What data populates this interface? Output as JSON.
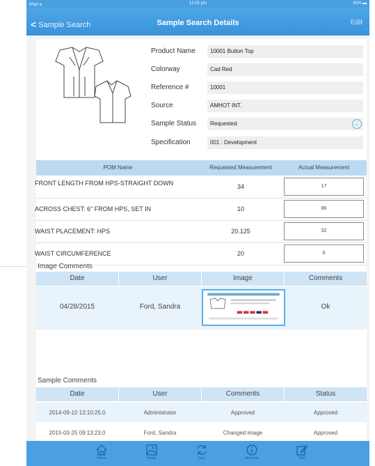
{
  "status_bar": {
    "left": "iPad ᯤ",
    "time": "12:01 pm",
    "battery": "91%"
  },
  "nav": {
    "back_label": "Sample Search",
    "title": "Sample Search Details",
    "edit_label": "Edit"
  },
  "product": {
    "fields": [
      {
        "label": "Product Name",
        "value": "10001 Button Top"
      },
      {
        "label": "Colorway",
        "value": "Cad Red"
      },
      {
        "label": "Reference #",
        "value": "10001"
      },
      {
        "label": "Source",
        "value": "AMHOT INT."
      },
      {
        "label": "Sample Status",
        "value": "Requested"
      },
      {
        "label": "Specification",
        "value": "001 : Development"
      }
    ]
  },
  "pom": {
    "headers": [
      "POM Name",
      "Requested Measurement",
      "Actual Measurement"
    ],
    "rows": [
      {
        "name": "FRONT LENGTH FROM HPS-STRAIGHT DOWN",
        "requested": "34",
        "actual": "17"
      },
      {
        "name": "ACROSS CHEST: 6\" FROM HPS, SET IN",
        "requested": "10",
        "actual": "86"
      },
      {
        "name": "WAIST PLACEMENT: HPS",
        "requested": "20.125",
        "actual": "32"
      },
      {
        "name": "WAIST CIRCUMFERENCE",
        "requested": "20",
        "actual": "0"
      }
    ]
  },
  "image_comments": {
    "section_label": "Image Comments",
    "headers": [
      "Date",
      "User",
      "Image",
      "Comments"
    ],
    "rows": [
      {
        "date": "04/28/2015",
        "user": "Ford, Sandra",
        "comment": "Ok"
      }
    ]
  },
  "sample_comments": {
    "section_label": "Sample Comments",
    "headers": [
      "Date",
      "User",
      "Comments",
      "Status"
    ],
    "rows": [
      {
        "date": "2014-09-10 13:10:25.0",
        "user": "Administrator",
        "comment": "Approved",
        "status": "Approved"
      },
      {
        "date": "2015-03-25 09:13:23.0",
        "user": "Ford, Sandra",
        "comment": "Changed image",
        "status": "Approved"
      }
    ]
  },
  "tabs": [
    {
      "label": "Home",
      "icon": "home-icon"
    },
    {
      "label": "Image",
      "icon": "image-icon"
    },
    {
      "label": "Sync",
      "icon": "sync-icon"
    },
    {
      "label": "About Us",
      "icon": "info-icon"
    },
    {
      "label": "T&C",
      "icon": "edit-icon"
    }
  ],
  "colors": {
    "accent": "#4aa0e3",
    "header_bg": "#bcd9f2",
    "row_tint": "#e8f3fb"
  }
}
